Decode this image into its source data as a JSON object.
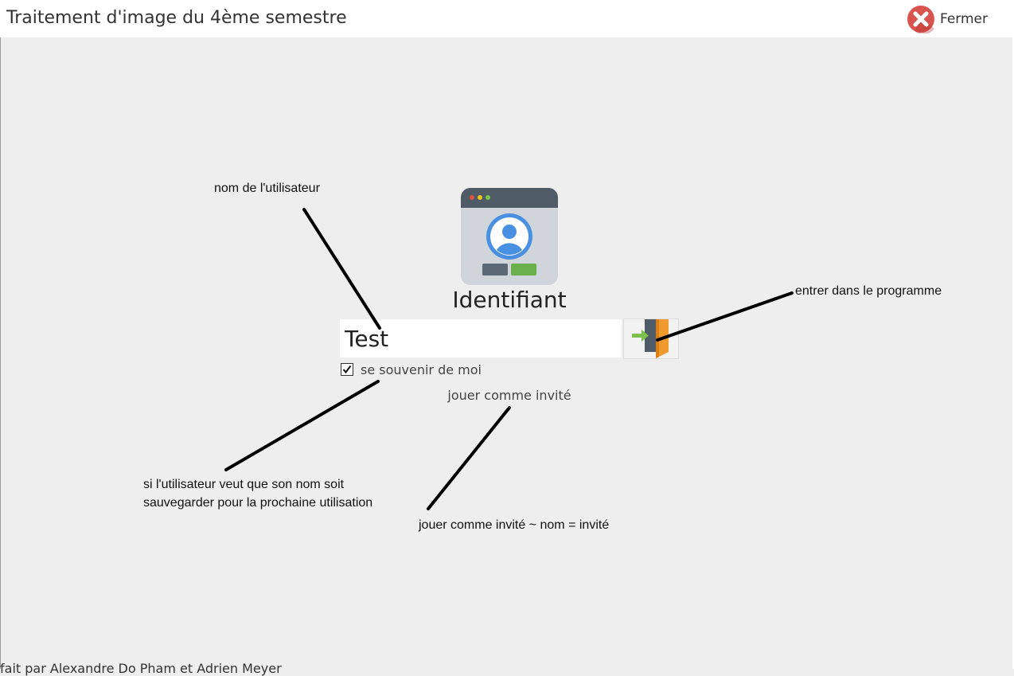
{
  "window": {
    "title": "Traitement d'image du 4ème semestre",
    "close_label": "Fermer"
  },
  "login": {
    "heading": "Identifiant",
    "username_value": "Test",
    "remember_label": "se souvenir de moi",
    "remember_checked": true,
    "guest_link": "jouer comme invité"
  },
  "annotations": {
    "username": "nom de l'utilisateur",
    "enter": "entrer dans le programme",
    "remember_line1": "si l'utilisateur veut que son nom soit",
    "remember_line2": "sauvegarder pour la prochaine utilisation",
    "guest": "jouer comme invité ~ nom = invité"
  },
  "footer": {
    "credits": "fait par Alexandre Do Pham et Adrien Meyer"
  },
  "icons": {
    "close": "close-icon",
    "login_window": "user-login-window-icon",
    "enter": "door-enter-icon",
    "check": "checkmark-icon"
  },
  "colors": {
    "close_red": "#d9534f",
    "door_orange": "#f09a2d",
    "arrow_green": "#7cc24a",
    "user_blue": "#4a90e2"
  }
}
